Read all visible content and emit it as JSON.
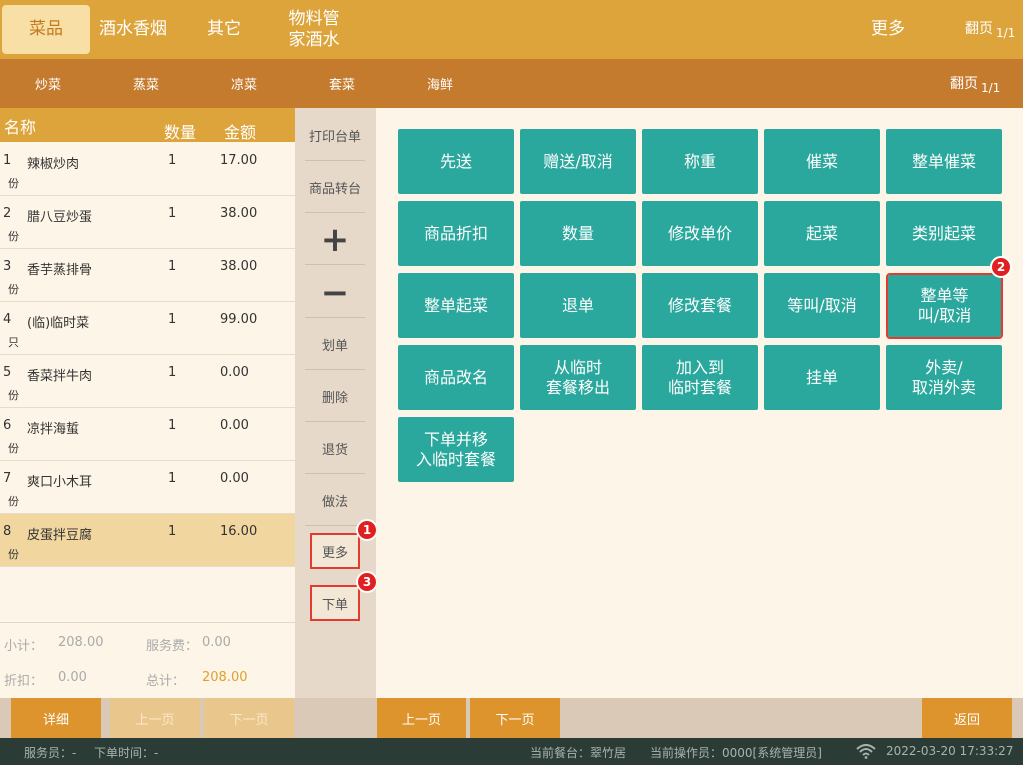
{
  "top_categories": [
    {
      "label": "菜品",
      "active": true
    },
    {
      "label": "酒水香烟",
      "active": false
    },
    {
      "label": "其它",
      "active": false
    },
    {
      "label": "物料管\n家酒水",
      "active": false
    }
  ],
  "top_more": "更多",
  "top_pager": {
    "label": "翻页",
    "page": "1/1"
  },
  "sub_categories": [
    "炒菜",
    "蒸菜",
    "凉菜",
    "套菜",
    "海鲜"
  ],
  "sub_pager": {
    "label": "翻页",
    "page": "1/1"
  },
  "order_header": {
    "name": "名称",
    "qty": "数量",
    "amount": "金额"
  },
  "order_items": [
    {
      "idx": "1",
      "name": "辣椒炒肉",
      "unit": "份",
      "qty": "1",
      "amount": "17.00"
    },
    {
      "idx": "2",
      "name": "腊八豆炒蛋",
      "unit": "份",
      "qty": "1",
      "amount": "38.00"
    },
    {
      "idx": "3",
      "name": "香芋蒸排骨",
      "unit": "份",
      "qty": "1",
      "amount": "38.00"
    },
    {
      "idx": "4",
      "name": "(临)临时菜",
      "unit": "只",
      "qty": "1",
      "amount": "99.00"
    },
    {
      "idx": "5",
      "name": "香菜拌牛肉",
      "unit": "份",
      "qty": "1",
      "amount": "0.00"
    },
    {
      "idx": "6",
      "name": "凉拌海蜇",
      "unit": "份",
      "qty": "1",
      "amount": "0.00"
    },
    {
      "idx": "7",
      "name": "爽口小木耳",
      "unit": "份",
      "qty": "1",
      "amount": "0.00"
    },
    {
      "idx": "8",
      "name": "皮蛋拌豆腐",
      "unit": "份",
      "qty": "1",
      "amount": "16.00"
    }
  ],
  "summary": {
    "subtotal_label": "小计：",
    "subtotal": "208.00",
    "service_label": "服务费：",
    "service": "0.00",
    "discount_label": "折扣：",
    "discount": "0.00",
    "total_label": "总计：",
    "total": "208.00",
    "total_color": "#e0a030"
  },
  "mid_buttons": {
    "print_table": "打印台单",
    "transfer": "商品转台",
    "plus": "+",
    "minus": "−",
    "strike": "划单",
    "delete": "删除",
    "return": "退货",
    "method": "做法",
    "more": "更多",
    "submit": "下单"
  },
  "badges": {
    "more": "1",
    "whole_wait": "2",
    "submit": "3"
  },
  "actions": [
    [
      "先送",
      "赠送/取消",
      "称重",
      "催菜",
      "整单催菜"
    ],
    [
      "商品折扣",
      "数量",
      "修改单价",
      "起菜",
      "类别起菜"
    ],
    [
      "整单起菜",
      "退单",
      "修改套餐",
      "等叫/取消",
      "整单等\n叫/取消"
    ],
    [
      "商品改名",
      "从临时\n套餐移出",
      "加入到\n临时套餐",
      "挂单",
      "外卖/\n取消外卖"
    ],
    [
      "下单并移\n入临时套餐"
    ]
  ],
  "bottom_buttons": {
    "detail": "详细",
    "prev_left": "上一页",
    "next_left": "下一页",
    "prev_right": "上一页",
    "next_right": "下一页",
    "back": "返回"
  },
  "status": {
    "waiter": "服务员：-",
    "order_time": "下单时间：-",
    "table": "当前餐台：翠竹居",
    "operator": "当前操作员：0000[系统管理员]",
    "datetime": "2022-03-20 17:33:27"
  },
  "colors": {
    "accent": "#dca43b",
    "teal": "#2aa89d",
    "highlight": "#e23b32"
  }
}
